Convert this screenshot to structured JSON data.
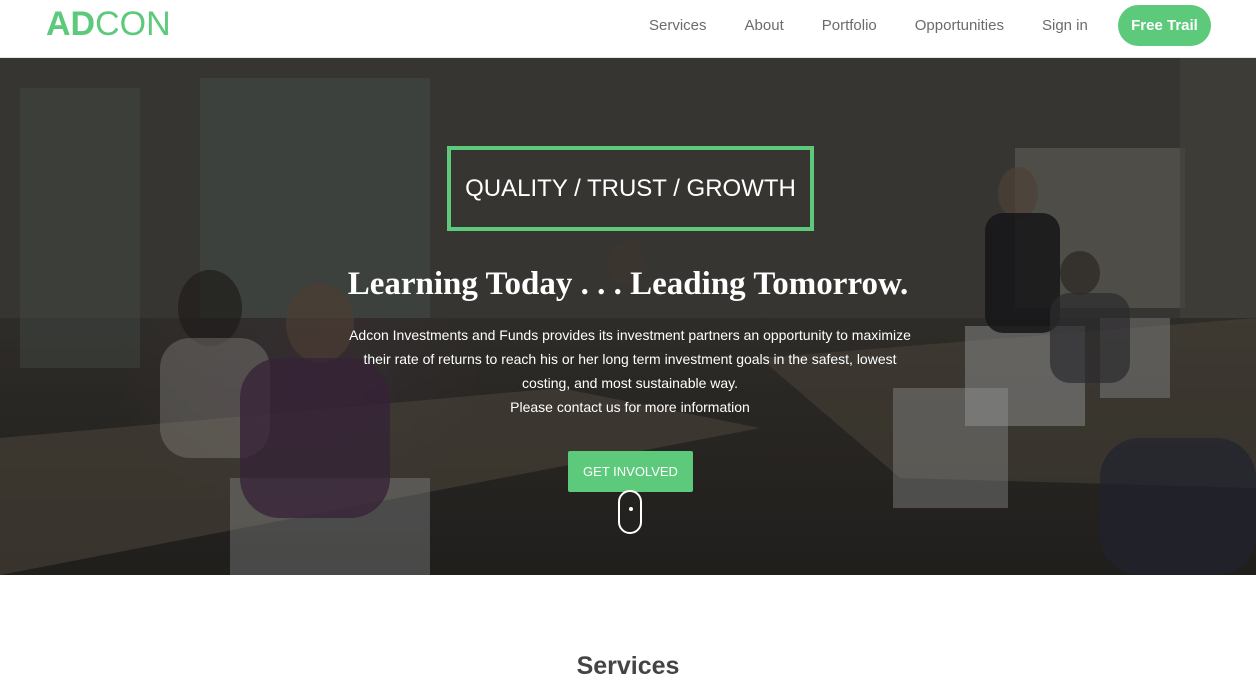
{
  "brand": {
    "part1": "AD",
    "part2": "CON",
    "color": "#5cc97b"
  },
  "nav": {
    "links": [
      "Services",
      "About",
      "Portfolio",
      "Opportunities",
      "Sign in"
    ],
    "cta_label": "Free Trail"
  },
  "hero": {
    "tagline": "QUALITY / TRUST / GROWTH",
    "title": "Learning Today . . . Leading Tomorrow.",
    "description_lines": [
      "Adcon Investments and Funds provides its investment partners an opportunity to maximize",
      "their rate of returns to reach his or her long term investment goals in the safest, lowest",
      "costing, and most sustainable way.",
      "Please contact us for more information"
    ],
    "button_label": "GET INVOLVED",
    "scroll_icon": "mouse-scroll-icon"
  },
  "services": {
    "title": "Services"
  },
  "colors": {
    "accent": "#5cc97b",
    "nav_text": "#6b6b6b"
  }
}
